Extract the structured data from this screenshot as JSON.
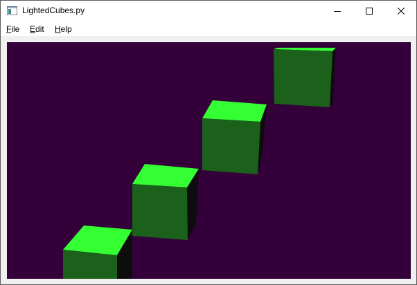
{
  "window": {
    "title": "LightedCubes.py"
  },
  "menu": {
    "file_label": "File",
    "edit_label": "Edit",
    "help_label": "Help",
    "file_mnemonic": "F",
    "file_rest": "ile",
    "edit_mnemonic": "E",
    "edit_rest": "dit",
    "help_mnemonic": "H",
    "help_rest": "elp"
  },
  "icons": {
    "app": "window-app-icon",
    "minimize": "minimize-icon",
    "maximize": "maximize-icon",
    "close": "close-icon"
  },
  "scene": {
    "background_color": "#33003a",
    "cube_top_color": "#33ff33",
    "cube_front_color": "#1b601b",
    "cube_side_color": "#0d0d0d",
    "cube_count": 4
  }
}
